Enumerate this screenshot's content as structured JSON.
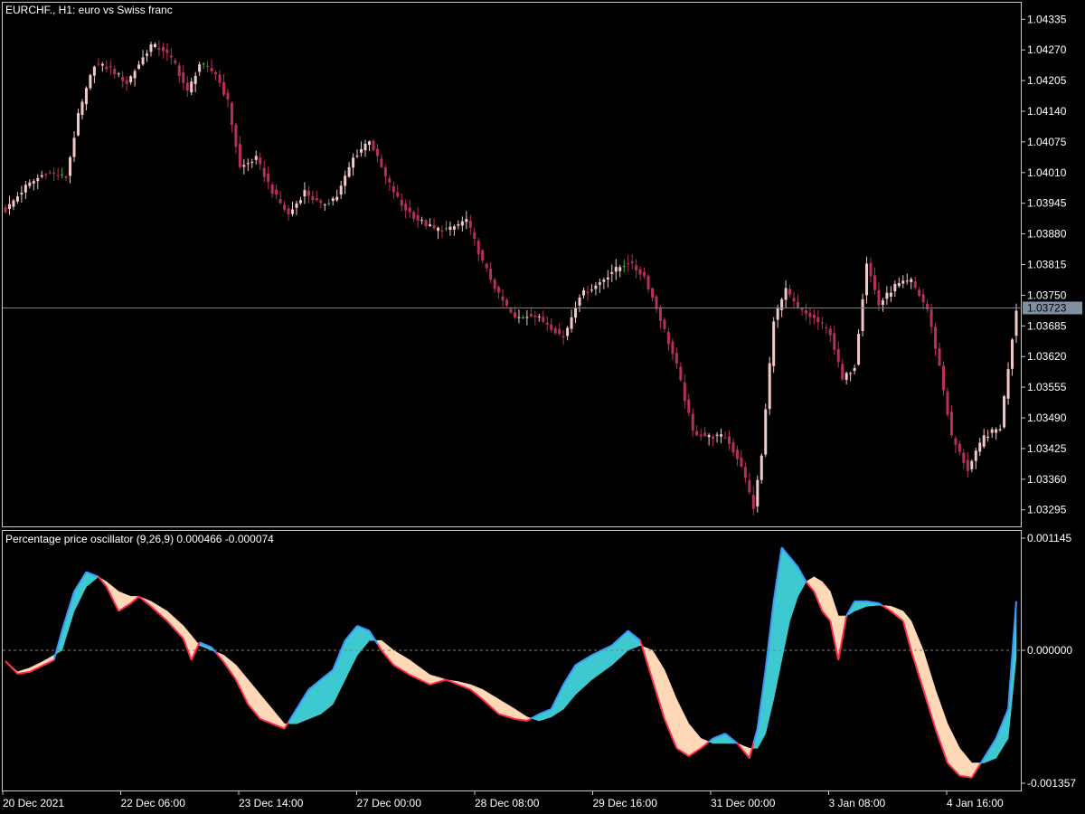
{
  "window": {
    "main_title": "EURCHF., H1:  euro vs Swiss franc",
    "osc_title": "Percentage price oscillator (9,26,9) 0.000466 -0.000074"
  },
  "colors": {
    "background": "#000000",
    "frame": "#c8c8c8",
    "candle_bull": "#f2c8c8",
    "candle_bear": "#b8305a",
    "candle_doji": "#3cb43c",
    "price_line": "#808080",
    "price_label_bg": "#8090a0",
    "osc_fill_up": "#3ec8d0",
    "osc_fill_down": "#ffd8b8",
    "osc_line_up": "#3c96ff",
    "osc_line_down": "#ff2a4a",
    "zero_line": "#808080"
  },
  "chart_data": [
    {
      "type": "candlestick",
      "name": "EURCHF., H1",
      "ylim": [
        1.0326,
        1.0437
      ],
      "y_ticks": [
        "1.04335",
        "1.04270",
        "1.04205",
        "1.04140",
        "1.04075",
        "1.04010",
        "1.03945",
        "1.03880",
        "1.03815",
        "1.03750",
        "1.03685",
        "1.03620",
        "1.03555",
        "1.03490",
        "1.03425",
        "1.03360",
        "1.03295"
      ],
      "current_price": "1.03723",
      "bars": 251,
      "anchors": [
        [
          0,
          1.0393
        ],
        [
          5,
          1.0398
        ],
        [
          10,
          1.0401
        ],
        [
          15,
          1.04
        ],
        [
          18,
          1.0413
        ],
        [
          22,
          1.0424
        ],
        [
          26,
          1.0423
        ],
        [
          30,
          1.042
        ],
        [
          33,
          1.0424
        ],
        [
          36,
          1.0428
        ],
        [
          39,
          1.0427
        ],
        [
          42,
          1.0424
        ],
        [
          45,
          1.0418
        ],
        [
          48,
          1.0424
        ],
        [
          52,
          1.0422
        ],
        [
          55,
          1.0416
        ],
        [
          58,
          1.0402
        ],
        [
          62,
          1.0404
        ],
        [
          66,
          1.0397
        ],
        [
          70,
          1.0392
        ],
        [
          74,
          1.0397
        ],
        [
          78,
          1.0394
        ],
        [
          82,
          1.0396
        ],
        [
          86,
          1.0404
        ],
        [
          90,
          1.0408
        ],
        [
          94,
          1.04
        ],
        [
          98,
          1.0394
        ],
        [
          102,
          1.0391
        ],
        [
          106,
          1.0389
        ],
        [
          110,
          1.0389
        ],
        [
          114,
          1.0391
        ],
        [
          118,
          1.0382
        ],
        [
          122,
          1.0375
        ],
        [
          126,
          1.037
        ],
        [
          130,
          1.0371
        ],
        [
          134,
          1.0369
        ],
        [
          138,
          1.0366
        ],
        [
          142,
          1.0375
        ],
        [
          146,
          1.0377
        ],
        [
          150,
          1.038
        ],
        [
          154,
          1.0382
        ],
        [
          158,
          1.0379
        ],
        [
          162,
          1.037
        ],
        [
          166,
          1.036
        ],
        [
          170,
          1.0346
        ],
        [
          174,
          1.0345
        ],
        [
          178,
          1.0345
        ],
        [
          182,
          1.0339
        ],
        [
          185,
          1.033
        ],
        [
          187,
          1.0341
        ],
        [
          190,
          1.037
        ],
        [
          193,
          1.0376
        ],
        [
          196,
          1.0372
        ],
        [
          200,
          1.037
        ],
        [
          204,
          1.0367
        ],
        [
          207,
          1.0357
        ],
        [
          210,
          1.036
        ],
        [
          213,
          1.0382
        ],
        [
          216,
          1.0373
        ],
        [
          220,
          1.0377
        ],
        [
          224,
          1.0378
        ],
        [
          228,
          1.0372
        ],
        [
          231,
          1.036
        ],
        [
          234,
          1.0345
        ],
        [
          238,
          1.0338
        ],
        [
          242,
          1.0345
        ],
        [
          246,
          1.0347
        ],
        [
          249,
          1.0366
        ],
        [
          250,
          1.0372
        ]
      ]
    },
    {
      "type": "area",
      "name": "Percentage price oscillator (9,26,9)",
      "ylim": [
        -0.001357,
        0.001145
      ],
      "y_ticks": [
        "0.001145",
        "0.000000",
        "-0.001357"
      ],
      "x_tick_labels": [
        "20 Dec 2021",
        "22 Dec 06:00",
        "23 Dec 14:00",
        "27 Dec 00:00",
        "28 Dec 08:00",
        "29 Dec 16:00",
        "31 Dec 00:00",
        "3 Jan 08:00",
        "4 Jan 16:00"
      ],
      "ppo_anchors": [
        [
          0,
          -0.00011
        ],
        [
          3,
          -0.00024
        ],
        [
          6,
          -0.00022
        ],
        [
          9,
          -0.00016
        ],
        [
          12,
          -0.0001
        ],
        [
          14,
          0.0002
        ],
        [
          17,
          0.0006
        ],
        [
          20,
          0.0008
        ],
        [
          23,
          0.00075
        ],
        [
          25,
          0.00065
        ],
        [
          28,
          0.0004
        ],
        [
          31,
          0.00048
        ],
        [
          33,
          0.00055
        ],
        [
          36,
          0.00045
        ],
        [
          40,
          0.0003
        ],
        [
          44,
          0.00012
        ],
        [
          46,
          -0.0001
        ],
        [
          48,
          8e-05
        ],
        [
          51,
          3e-05
        ],
        [
          54,
          -0.00012
        ],
        [
          57,
          -0.0003
        ],
        [
          60,
          -0.00055
        ],
        [
          63,
          -0.0007
        ],
        [
          66,
          -0.00075
        ],
        [
          69,
          -0.0008
        ],
        [
          72,
          -0.0006
        ],
        [
          75,
          -0.0004
        ],
        [
          78,
          -0.0003
        ],
        [
          81,
          -0.0002
        ],
        [
          84,
          0.0001
        ],
        [
          87,
          0.00025
        ],
        [
          90,
          0.0002
        ],
        [
          93,
          0.0
        ],
        [
          96,
          -0.00015
        ],
        [
          100,
          -0.00025
        ],
        [
          105,
          -0.00035
        ],
        [
          109,
          -0.0003
        ],
        [
          112,
          -0.00035
        ],
        [
          115,
          -0.0004
        ],
        [
          118,
          -0.0005
        ],
        [
          122,
          -0.00065
        ],
        [
          126,
          -0.0007
        ],
        [
          129,
          -0.00072
        ],
        [
          132,
          -0.00065
        ],
        [
          135,
          -0.0006
        ],
        [
          138,
          -0.00035
        ],
        [
          141,
          -0.00015
        ],
        [
          145,
          -5e-05
        ],
        [
          150,
          5e-05
        ],
        [
          154,
          0.0002
        ],
        [
          157,
          0.0001
        ],
        [
          160,
          -0.0003
        ],
        [
          163,
          -0.0007
        ],
        [
          166,
          -0.001
        ],
        [
          169,
          -0.00108
        ],
        [
          172,
          -0.001
        ],
        [
          175,
          -0.0009
        ],
        [
          178,
          -0.00085
        ],
        [
          181,
          -0.00095
        ],
        [
          184,
          -0.0011
        ],
        [
          186,
          -0.0008
        ],
        [
          188,
          -0.0002
        ],
        [
          190,
          0.0005
        ],
        [
          192,
          0.00105
        ],
        [
          194,
          0.00095
        ],
        [
          196,
          0.00085
        ],
        [
          198,
          0.0007
        ],
        [
          200,
          0.0006
        ],
        [
          202,
          0.0004
        ],
        [
          204,
          0.0003
        ],
        [
          206,
          -0.0001
        ],
        [
          208,
          0.00035
        ],
        [
          210,
          0.0005
        ],
        [
          213,
          0.0005
        ],
        [
          216,
          0.00048
        ],
        [
          219,
          0.0004
        ],
        [
          222,
          0.0003
        ],
        [
          224,
          0.0
        ],
        [
          227,
          -0.0004
        ],
        [
          230,
          -0.0008
        ],
        [
          233,
          -0.00115
        ],
        [
          236,
          -0.00128
        ],
        [
          239,
          -0.0013
        ],
        [
          242,
          -0.0011
        ],
        [
          245,
          -0.0009
        ],
        [
          248,
          -0.0006
        ],
        [
          250,
          0.0005
        ]
      ],
      "signal_anchors": [
        [
          0,
          -0.00011
        ],
        [
          3,
          -0.00022
        ],
        [
          6,
          -0.00018
        ],
        [
          9,
          -0.00012
        ],
        [
          12,
          -5e-05
        ],
        [
          14,
          0.0
        ],
        [
          17,
          0.0004
        ],
        [
          20,
          0.00065
        ],
        [
          23,
          0.00075
        ],
        [
          25,
          0.0007
        ],
        [
          28,
          0.0006
        ],
        [
          31,
          0.00055
        ],
        [
          33,
          0.00055
        ],
        [
          36,
          0.0005
        ],
        [
          40,
          0.0004
        ],
        [
          44,
          0.00025
        ],
        [
          46,
          0.00015
        ],
        [
          48,
          5e-05
        ],
        [
          51,
          0.0
        ],
        [
          54,
          -5e-05
        ],
        [
          57,
          -0.00015
        ],
        [
          60,
          -0.0003
        ],
        [
          63,
          -0.00045
        ],
        [
          66,
          -0.0006
        ],
        [
          69,
          -0.00075
        ],
        [
          72,
          -0.00075
        ],
        [
          75,
          -0.0007
        ],
        [
          78,
          -0.00065
        ],
        [
          81,
          -0.00055
        ],
        [
          84,
          -0.0003
        ],
        [
          87,
          -5e-05
        ],
        [
          90,
          0.0001
        ],
        [
          93,
          0.0001
        ],
        [
          96,
          0.0
        ],
        [
          100,
          -0.0001
        ],
        [
          105,
          -0.00025
        ],
        [
          109,
          -0.0003
        ],
        [
          112,
          -0.00032
        ],
        [
          115,
          -0.00035
        ],
        [
          118,
          -0.0004
        ],
        [
          122,
          -0.0005
        ],
        [
          126,
          -0.0006
        ],
        [
          129,
          -0.00068
        ],
        [
          132,
          -0.00072
        ],
        [
          135,
          -0.00068
        ],
        [
          138,
          -0.0006
        ],
        [
          141,
          -0.00045
        ],
        [
          145,
          -0.0003
        ],
        [
          150,
          -0.00015
        ],
        [
          154,
          0.0
        ],
        [
          157,
          5e-05
        ],
        [
          160,
          0.0
        ],
        [
          163,
          -0.0002
        ],
        [
          166,
          -0.0005
        ],
        [
          169,
          -0.00075
        ],
        [
          172,
          -0.0009
        ],
        [
          175,
          -0.00095
        ],
        [
          178,
          -0.00095
        ],
        [
          181,
          -0.00095
        ],
        [
          184,
          -0.001
        ],
        [
          186,
          -0.001
        ],
        [
          188,
          -0.00085
        ],
        [
          190,
          -0.0005
        ],
        [
          192,
          -0.0001
        ],
        [
          194,
          0.0003
        ],
        [
          196,
          0.00055
        ],
        [
          198,
          0.0007
        ],
        [
          200,
          0.00075
        ],
        [
          202,
          0.0007
        ],
        [
          204,
          0.0006
        ],
        [
          206,
          0.00035
        ],
        [
          208,
          0.00035
        ],
        [
          210,
          0.0004
        ],
        [
          213,
          0.00045
        ],
        [
          216,
          0.00046
        ],
        [
          219,
          0.00045
        ],
        [
          222,
          0.0004
        ],
        [
          224,
          0.0003
        ],
        [
          227,
          0.0
        ],
        [
          230,
          -0.0004
        ],
        [
          233,
          -0.00075
        ],
        [
          236,
          -0.001
        ],
        [
          239,
          -0.00115
        ],
        [
          242,
          -0.00115
        ],
        [
          245,
          -0.0011
        ],
        [
          248,
          -0.0009
        ],
        [
          250,
          -7e-05
        ]
      ]
    }
  ]
}
